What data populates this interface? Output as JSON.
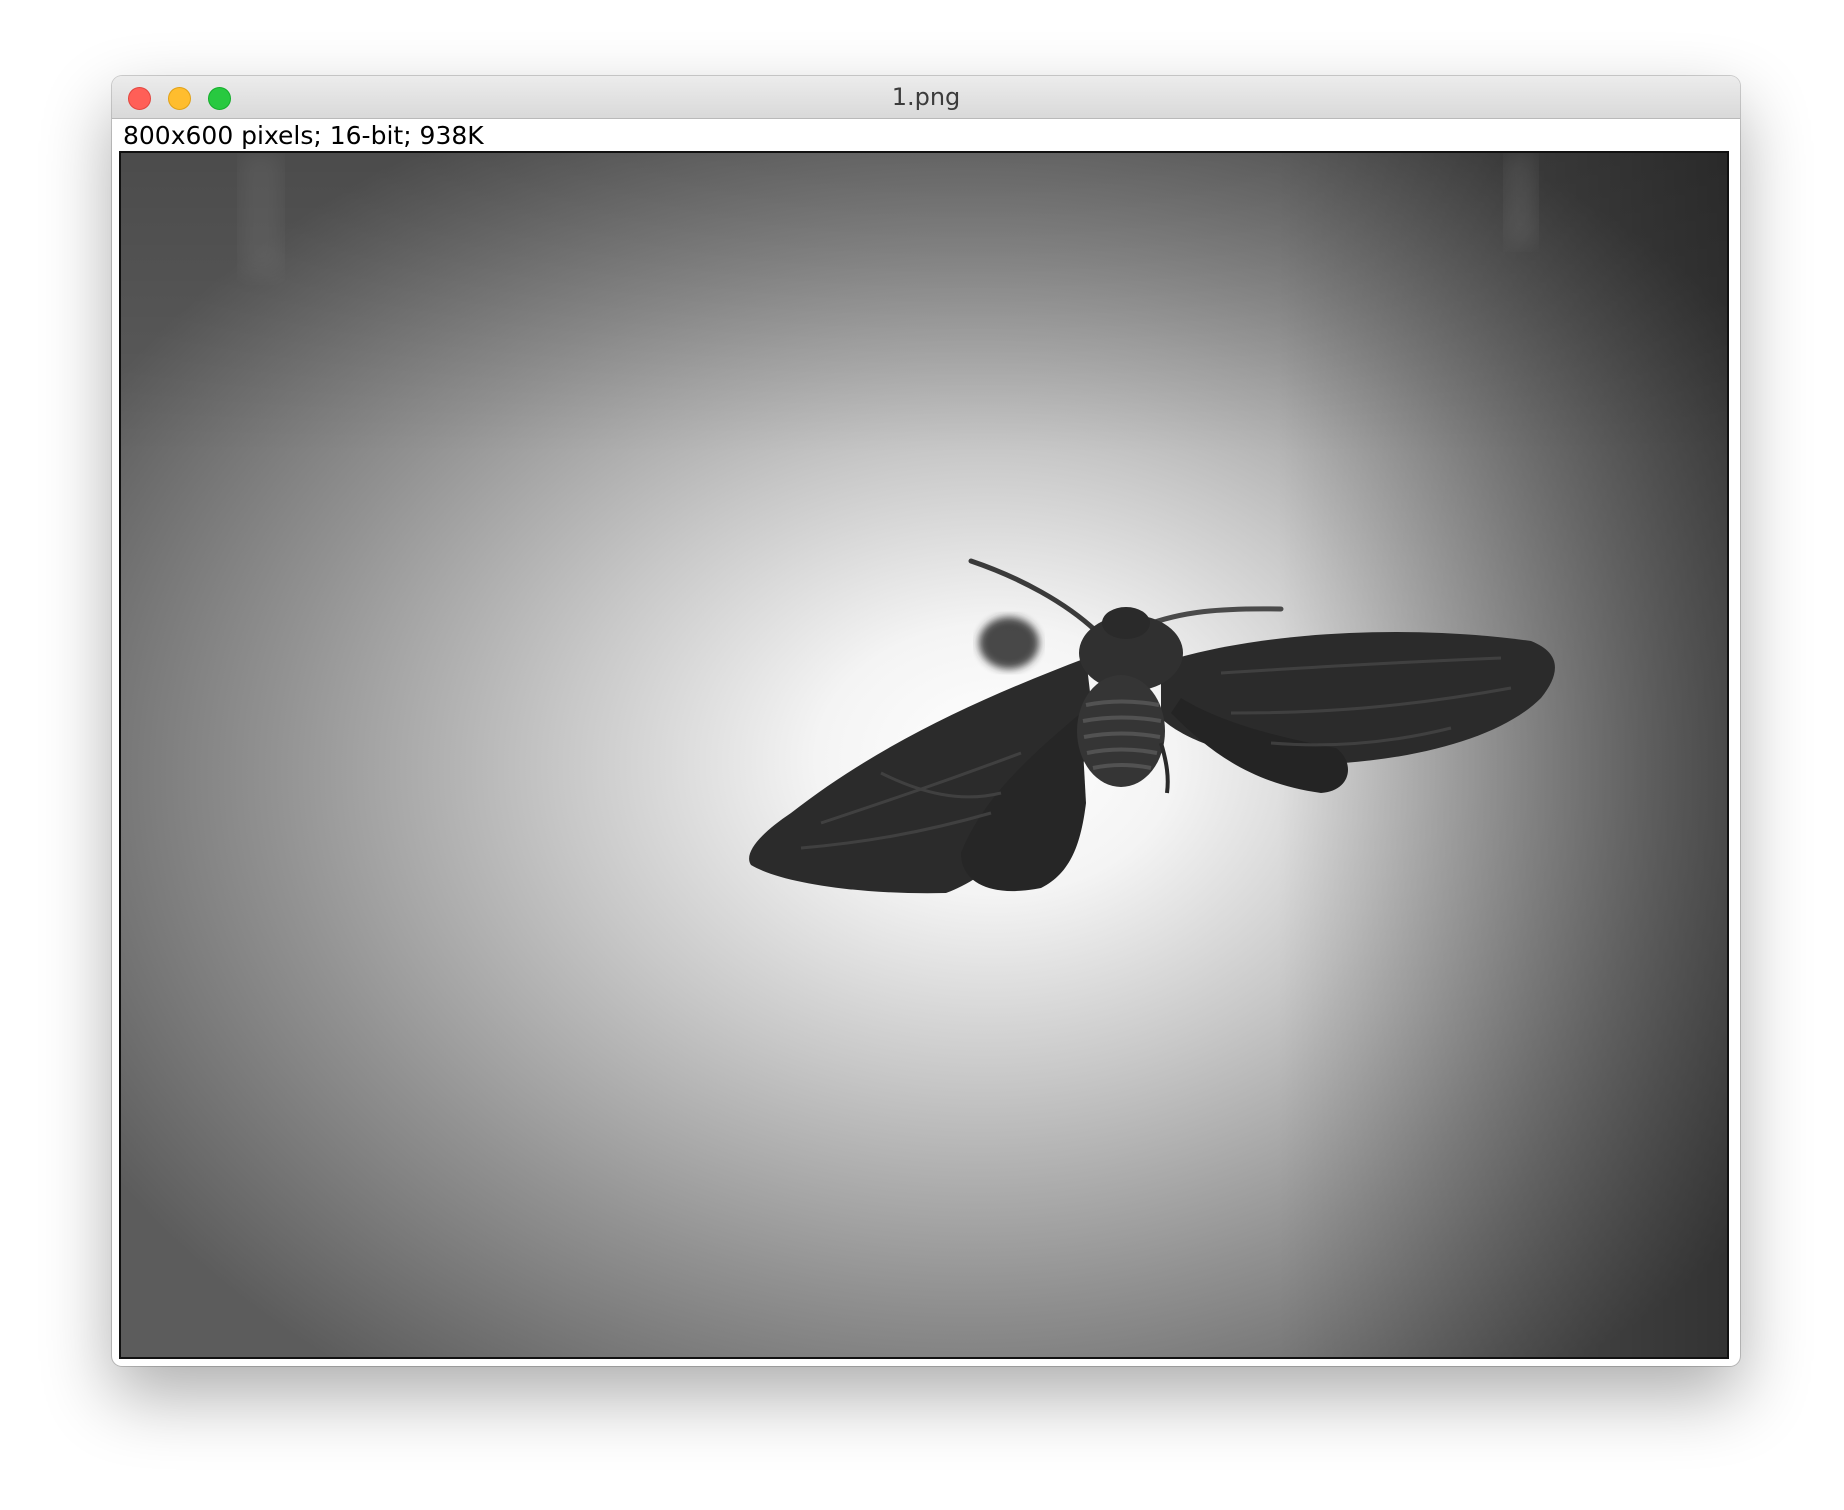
{
  "window": {
    "title": "1.png",
    "traffic_lights": [
      "close",
      "minimize",
      "zoom"
    ]
  },
  "image_info": {
    "text": "800x600 pixels; 16-bit; 938K"
  },
  "image": {
    "subject": "moth",
    "colors": {
      "background_dark": "#5a5a5a",
      "background_light": "#f6f6f6",
      "moth": "#2b2b2b"
    }
  }
}
